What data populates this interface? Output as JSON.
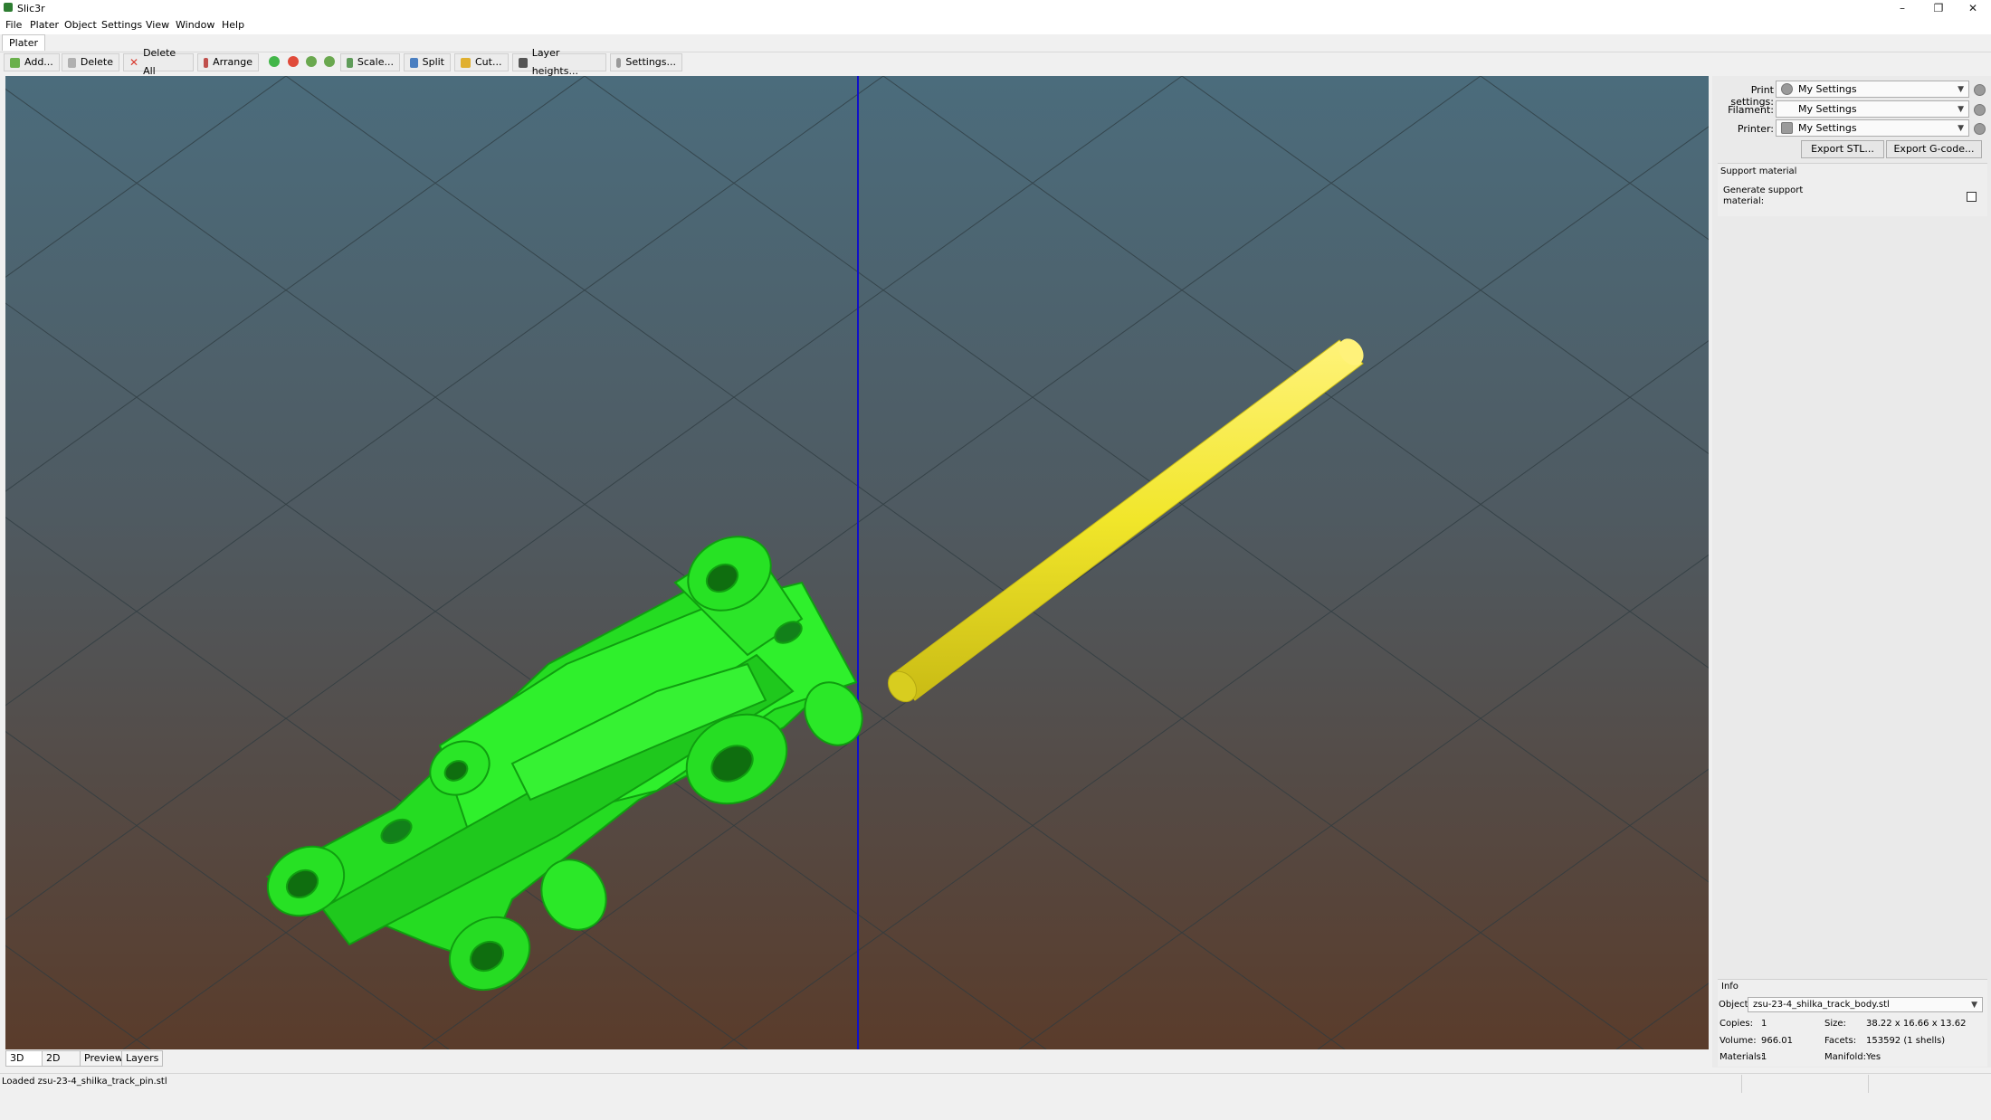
{
  "window": {
    "title": "Slic3r",
    "minimize": "–",
    "restore": "❐",
    "close": "✕"
  },
  "menu": [
    "File",
    "Plater",
    "Object",
    "Settings",
    "View",
    "Window",
    "Help"
  ],
  "tabs": {
    "plater": "Plater"
  },
  "toolbar": {
    "add": "Add...",
    "delete": "Delete",
    "delete_all": "Delete All",
    "arrange": "Arrange",
    "scale": "Scale...",
    "split": "Split",
    "cut": "Cut...",
    "layer_heights": "Layer heights...",
    "settings": "Settings..."
  },
  "view_tabs": [
    "3D",
    "2D",
    "Preview",
    "Layers"
  ],
  "status": {
    "text": "Loaded zsu-23-4_shilka_track_pin.stl"
  },
  "panel": {
    "print_settings_label": "Print settings:",
    "print_settings_value": "My Settings",
    "filament_label": "Filament:",
    "filament_value": "My Settings",
    "printer_label": "Printer:",
    "printer_value": "My Settings",
    "export_stl": "Export STL...",
    "export_gcode": "Export G-code...",
    "support_heading": "Support material",
    "support_label_1": "Generate support",
    "support_label_2": "material:",
    "support_checked": false
  },
  "info": {
    "heading": "Info",
    "object_label": "Object:",
    "object_value": "zsu-23-4_shilka_track_body.stl",
    "copies_label": "Copies:",
    "copies_value": "1",
    "size_label": "Size:",
    "size_value": "38.22 x 16.66 x 13.62",
    "volume_label": "Volume:",
    "volume_value": "966.01",
    "facets_label": "Facets:",
    "facets_value": "153592 (1 shells)",
    "materials_label": "Materials:",
    "materials_value": "1",
    "manifold_label": "Manifold:",
    "manifold_value": "Yes"
  },
  "colors": {
    "track_body": "#22e01f",
    "track_pin": "#f2ea2c",
    "axis_line": "#1010c8",
    "bg_top": "#4a6a7a",
    "bg_bottom": "#5a3c2a"
  }
}
